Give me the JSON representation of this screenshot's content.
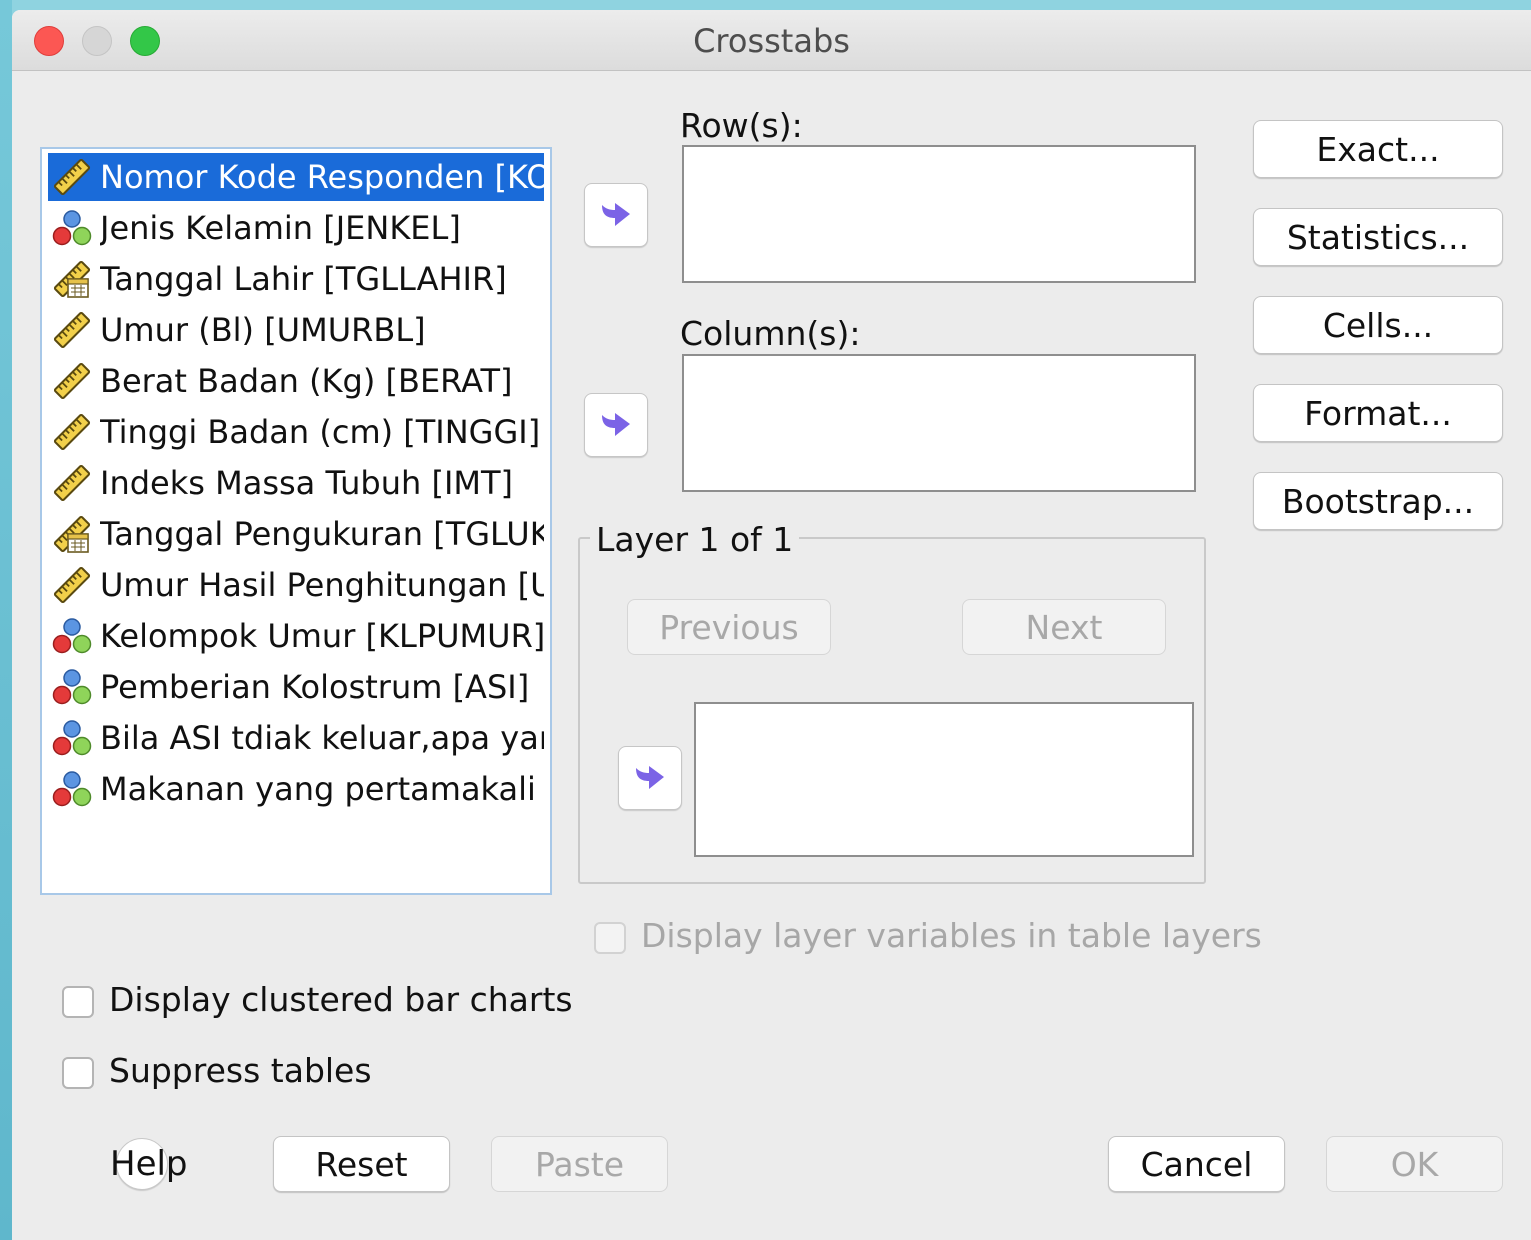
{
  "window": {
    "title": "Crosstabs"
  },
  "variables": [
    {
      "label": "Nomor Kode Responden [KO...",
      "icon": "scale-ruler-icon",
      "selected": true
    },
    {
      "label": "Jenis Kelamin [JENKEL]",
      "icon": "nominal-icon"
    },
    {
      "label": "Tanggal Lahir [TGLLAHIR]",
      "icon": "date-ruler-icon"
    },
    {
      "label": "Umur (Bl) [UMURBL]",
      "icon": "scale-ruler-icon"
    },
    {
      "label": "Berat Badan (Kg) [BERAT]",
      "icon": "scale-ruler-icon"
    },
    {
      "label": "Tinggi Badan (cm) [TINGGI]",
      "icon": "scale-ruler-icon"
    },
    {
      "label": "Indeks Massa Tubuh [IMT]",
      "icon": "scale-ruler-icon"
    },
    {
      "label": "Tanggal Pengukuran [TGLUK...",
      "icon": "date-ruler-icon"
    },
    {
      "label": "Umur Hasil Penghitungan [UM...",
      "icon": "scale-ruler-icon"
    },
    {
      "label": "Kelompok Umur [KLPUMUR]",
      "icon": "nominal-icon"
    },
    {
      "label": "Pemberian Kolostrum [ASI]",
      "icon": "nominal-icon"
    },
    {
      "label": "Bila ASI tdiak keluar,apa yang...",
      "icon": "nominal-icon"
    },
    {
      "label": "Makanan yang pertamakali di...",
      "icon": "nominal-icon"
    }
  ],
  "rows": {
    "label": "Row(s):"
  },
  "columns": {
    "label": "Column(s):"
  },
  "layer": {
    "title": "Layer 1 of 1",
    "previous": "Previous",
    "next": "Next"
  },
  "side_buttons": {
    "exact": "Exact...",
    "statistics": "Statistics...",
    "cells": "Cells...",
    "format": "Format...",
    "bootstrap": "Bootstrap..."
  },
  "options": {
    "display_layer": "Display layer variables in table layers",
    "clustered_bar": "Display clustered bar charts",
    "suppress_tables": "Suppress tables"
  },
  "footer": {
    "help": "Help",
    "reset": "Reset",
    "paste": "Paste",
    "cancel": "Cancel",
    "ok": "OK"
  },
  "colors": {
    "selection": "#1a6bd9",
    "arrow": "#7b63e6",
    "close": "#fc5753",
    "zoom": "#33c748"
  }
}
